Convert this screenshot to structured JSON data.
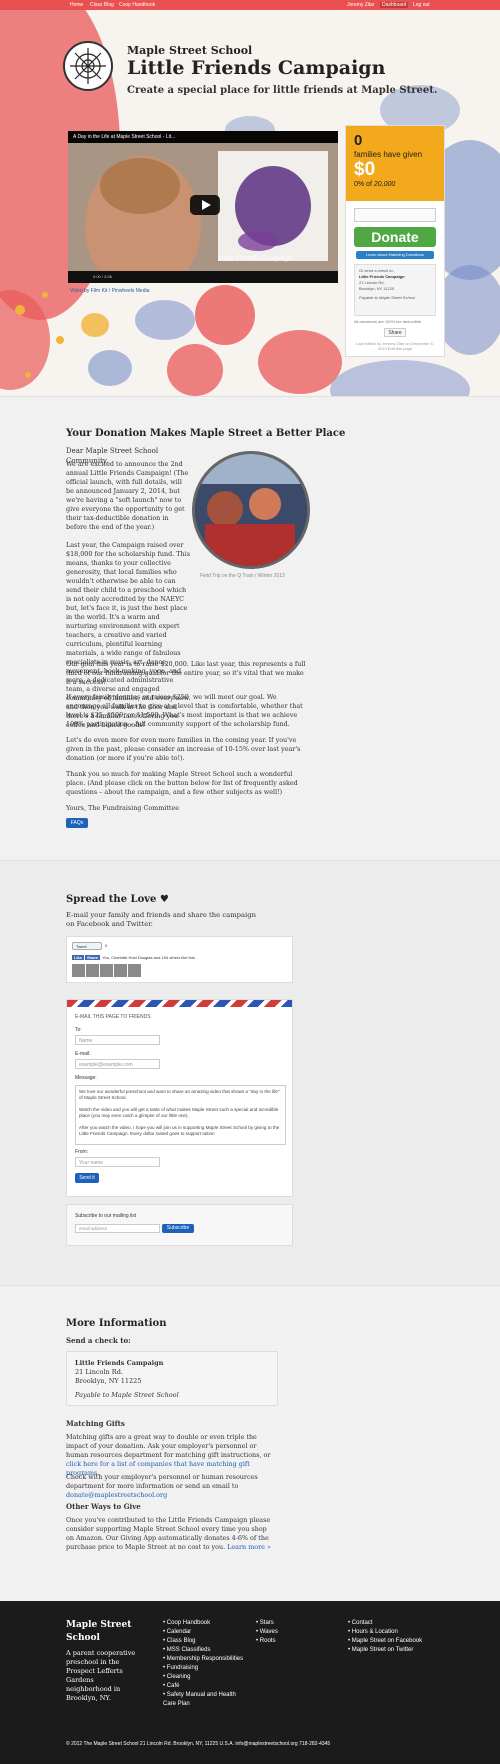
{
  "topbar": {
    "links": [
      "Home",
      "Class Blog",
      "Coop Handbook"
    ],
    "user": "Jeremy Zilar",
    "dashboard": "Dashboard",
    "logout": "Log out"
  },
  "hero": {
    "org": "Maple Street School",
    "campaign": "Little Friends Campaign",
    "tagline": "Create a special place for little friends at Maple Street.",
    "video_title": "A Day in the Life at Maple Street School - Lit...",
    "video_overlay": "Little Friends Campaign",
    "video_time": "0:00 / 2:06",
    "video_credit": "Video by Film Kit / Pinwheels Media"
  },
  "donate": {
    "families_count": "0",
    "families_label": "families have given",
    "amount": "$0",
    "goal_prefix": "0% of",
    "goal": "20,000",
    "button": "Donate",
    "match_button": "Learn about Matching Donations",
    "check_lines": [
      "Or send a check to:",
      "Little Friends Campaign",
      "21 Lincoln Rd.",
      "Brooklyn, NY 11225",
      "",
      "Payable to Maple Street School"
    ],
    "tax_note": "All donations are 100% tax deductible.",
    "share": "Share",
    "updated": "Last edited by Jeremy Zilar on December 6, 2013  Edit this page"
  },
  "intro": {
    "title": "Your Donation Makes Maple Street a Better Place",
    "greeting": "Dear Maple Street School Community,",
    "p1": "We are excited to announce the 2nd annual Little Friends Campaign! (The official launch, with full details, will be announced January 2, 2014, but we're having a \"soft launch\" now to give everyone the opportunity to get their tax-deductible donation in before the end of the year.)",
    "p2": "Last year, the Campaign raised over $18,000 for the scholarship fund. This means, thanks to your collective generosity, that local families who wouldn't otherwise be able to can send their child to a preschool which is not only accredited by the NAEYC but, let's face it, is just the best place in the world. It's a warm and nurturing environment with expert teachers, a creative and varied curriculum, plentiful learning materials, a wide range of fabulous specialists in music, art, dance, movement, book-making, yoga, and more, a dedicated administrative team, a diverse and engaged community of families, and every now and then you walk in the door and there's a familiar face offering you coffee and baked goods!",
    "p3": "Our goal this year is to raise $20,000. Like last year, this represents a full third of our fundraising goal for the entire year, so it's vital that we make it a success!",
    "p4": "If every family donates or raises $250, we will meet our goal. We encourage all families to give at a level that is comfortable, whether that level is $25, $500, or $1,500. What's most important is that we achieve 100% participation – full community support of the scholarship fund.",
    "p5": "Let's do even more for even more families in the coming year. If you've given in the past, please consider an increase of 10-15% over last year's donation (or more if you're able to!).",
    "p6": "Thank you so much for making Maple Street School such a wonderful place. (And please click on the button below for list of frequently asked questions – about the campaign, and a few other subjects as well!)",
    "sign": "Yours, The Fundraising Committee",
    "faq": "FAQs",
    "photo_caption": "Field Trip on the Q Train / Winter 2013"
  },
  "spread": {
    "title": "Spread the Love ♥",
    "desc": "E-mail your family and friends and share the campaign on Facebook and Twitter.",
    "tweet": "Tweet",
    "tweet_count": "0",
    "fb_like": "Like",
    "fb_share": "Share",
    "fb_text": "You, Charlotte Hold Douglas and 194 others like this."
  },
  "email": {
    "heading": "E-MAIL THIS PAGE TO FRIENDS",
    "to_label": "To:",
    "to_placeholder": "Name",
    "email_label": "E-mail:",
    "email_placeholder": "example@example.com",
    "message_label": "Message:",
    "message": "We love our wonderful preschool and want to share an amazing video that shows a \"day in the life\" of Maple Street School.\n\nWatch the video and you will get a taste of what makes Maple Street such a special and incredible place (you may even catch a glimpse of our little one).\n\nAfter you watch the video, I hope you will join us in supporting Maple Street School by giving to the Little Friends Campaign. Every dollar raised goes to support tuition",
    "from_label": "From:",
    "from_placeholder": "Your name",
    "send": "Send it"
  },
  "subscribe": {
    "label": "Subscribe to our mailing list",
    "placeholder": "email address",
    "button": "Subscribe"
  },
  "more": {
    "title": "More Information",
    "check_heading": "Send a check to:",
    "check_name": "Little Friends Campaign",
    "check_addr1": "21 Lincoln Rd.",
    "check_addr2": "Brooklyn, NY 11225",
    "check_payable": "Payable to Maple Street School",
    "matching_heading": "Matching Gifts",
    "matching_p1": "Matching gifts are a great way to double or even triple the impact of your donation. Ask your employer's personnel or human resources department for matching gift instructions, or ",
    "matching_link": "click here for a list of companies that have matching gift programs.",
    "matching_p2": "Check with your employer's personnel or human resources department for more information or send an email to ",
    "matching_email": "donate@maplestreetschool.org",
    "other_heading": "Other Ways to Give",
    "other_p": "Once you've contributed to the Little Friends Campaign please consider supporting Maple Street School every time you shop on Amazon. Our Giving App automatically donates 4-6% of the purchase price to Maple Street at no cost to you. ",
    "other_link": "Learn more »"
  },
  "footer": {
    "title": "Maple Street School",
    "desc": "A parent cooperative preschool in the Prospect Lefferts Gardens neighborhood in Brooklyn, NY.",
    "col1": [
      "Coop Handbook",
      "Calendar",
      "Class Blog",
      "MSS Classifieds",
      "Membership Responsibilities",
      "Fundraising",
      "Cleaning",
      "Café",
      "Safety Manual and Health Care Plan"
    ],
    "col2": [
      "Stars",
      "Waves",
      "Roots"
    ],
    "col3": [
      "Contact",
      "Hours & Location",
      "Maple Street on Facebook",
      "Maple Street on Twitter"
    ],
    "bottom": "© 2012 The Maple Street School  21 Lincoln Rd. Brooklyn, NY, 11225 U.S.A.   info@maplestreetschool.org  718-282-4345"
  }
}
